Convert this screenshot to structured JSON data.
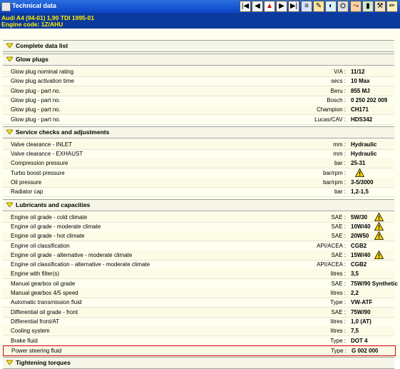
{
  "window": {
    "title": "Technical data"
  },
  "vehicle": {
    "line1": "Audi   A4 (94-01) 1,90 TDI 1995-01",
    "line2": "Engine code: 1Z/AHU"
  },
  "toolbar": [
    "first-icon",
    "prev-icon",
    "warning-icon",
    "next-icon",
    "last-icon",
    "doc-icon",
    "tool-icon",
    "gauge-icon",
    "car-icon",
    "brush-icon",
    "battery-icon",
    "tools-icon",
    "pencil-icon"
  ],
  "sections": [
    {
      "title": "Complete data list",
      "rows": []
    },
    {
      "title": "Glow plugs",
      "rows": [
        {
          "label": "Glow plug nominal rating",
          "unit": "V/A :",
          "value": "11/12"
        },
        {
          "label": "Glow plug activation time",
          "unit": "secs :",
          "value": "10 Max"
        },
        {
          "label": "Glow plug - part no.",
          "unit": "Beru :",
          "value": "855 MJ"
        },
        {
          "label": "Glow plug - part no.",
          "unit": "Bosch :",
          "value": "0 250 202 009"
        },
        {
          "label": "Glow plug - part no.",
          "unit": "Champion :",
          "value": "CH171"
        },
        {
          "label": "Glow plug - part no.",
          "unit": "Lucas/CAV :",
          "value": "HDS342"
        }
      ]
    },
    {
      "title": "Service checks and adjustments",
      "rows": [
        {
          "label": "Valve clearance - INLET",
          "unit": "mm :",
          "value": "Hydraulic"
        },
        {
          "label": "Valve clearance - EXHAUST",
          "unit": "mm :",
          "value": "Hydraulic"
        },
        {
          "label": "Compression pressure",
          "unit": "bar :",
          "value": "25-31"
        },
        {
          "label": "Turbo boost pressure",
          "unit": "bar/rpm :",
          "value": "",
          "warn": true
        },
        {
          "label": "Oil pressure",
          "unit": "bar/rpm :",
          "value": "3-5/3000"
        },
        {
          "label": "Radiator cap",
          "unit": "bar :",
          "value": "1,2-1,5"
        }
      ]
    },
    {
      "title": "Lubricants and capacities",
      "rows": [
        {
          "label": "Engine oil grade - cold climate",
          "unit": "SAE :",
          "value": "5W/30",
          "warn": true
        },
        {
          "label": "Engine oil grade - moderate climate",
          "unit": "SAE :",
          "value": "10W/40",
          "warn": true
        },
        {
          "label": "Engine oil grade - hot climate",
          "unit": "SAE :",
          "value": "20W50",
          "warn": true
        },
        {
          "label": "Engine oil classification",
          "unit": "API/ACEA :",
          "value": "CGB2"
        },
        {
          "label": "Engine oil grade - alternative - moderate climate",
          "unit": "SAE :",
          "value": "15W/40",
          "warn": true
        },
        {
          "label": "Engine oil classification - alternative - moderate climate",
          "unit": "API/ACEA :",
          "value": "CGB2"
        },
        {
          "label": "Engine with filter(s)",
          "unit": "litres :",
          "value": "3,5"
        },
        {
          "label": "Manual gearbox oil grade",
          "unit": "SAE :",
          "value": "75W/90  Synthetic"
        },
        {
          "label": "Manual gearbox 4/5 speed",
          "unit": "litres :",
          "value": "2,2"
        },
        {
          "label": "Automatic transmission fluid",
          "unit": "Type :",
          "value": "VW-ATF"
        },
        {
          "label": "Differential oil grade - front",
          "unit": "SAE :",
          "value": "75W/90"
        },
        {
          "label": "Differential front/AT",
          "unit": "litres :",
          "value": "1,0 (AT)"
        },
        {
          "label": "Cooling system",
          "unit": "litres :",
          "value": "7,5"
        },
        {
          "label": "Brake fluid",
          "unit": "Type :",
          "value": "DOT 4"
        },
        {
          "label": "Power steering fluid",
          "unit": "Type :",
          "value": "G 002 000",
          "highlight": true
        }
      ]
    },
    {
      "title": "Tightening torques",
      "rows": []
    }
  ]
}
